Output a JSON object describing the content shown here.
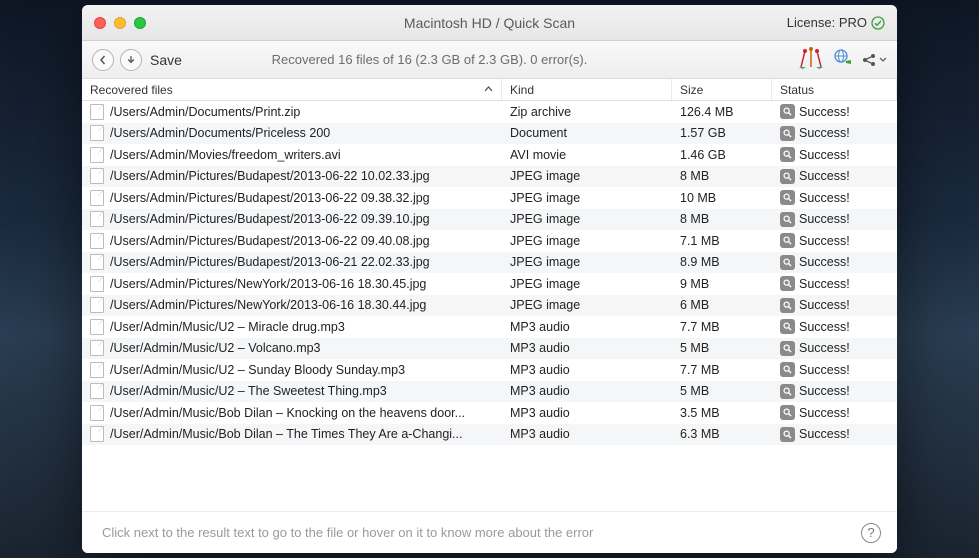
{
  "window": {
    "title": "Macintosh HD / Quick Scan",
    "license_label": "License: PRO"
  },
  "toolbar": {
    "save_label": "Save",
    "status": "Recovered 16 files of 16 (2.3 GB of 2.3 GB). 0 error(s)."
  },
  "columns": {
    "path": "Recovered files",
    "kind": "Kind",
    "size": "Size",
    "status": "Status"
  },
  "status_text": "Success!",
  "footer": {
    "hint": "Click next to the result text to go to the file or hover on it to know more about the error"
  },
  "rows": [
    {
      "path": "/Users/Admin/Documents/Print.zip",
      "kind": "Zip archive",
      "size": "126.4 MB"
    },
    {
      "path": "/Users/Admin/Documents/Priceless 200",
      "kind": "Document",
      "size": "1.57 GB"
    },
    {
      "path": "/Users/Admin/Movies/freedom_writers.avi",
      "kind": "AVI movie",
      "size": "1.46 GB"
    },
    {
      "path": "/Users/Admin/Pictures/Budapest/2013-06-22 10.02.33.jpg",
      "kind": "JPEG image",
      "size": "8 MB"
    },
    {
      "path": "/Users/Admin/Pictures/Budapest/2013-06-22 09.38.32.jpg",
      "kind": "JPEG image",
      "size": "10 MB"
    },
    {
      "path": "/Users/Admin/Pictures/Budapest/2013-06-22 09.39.10.jpg",
      "kind": "JPEG image",
      "size": "8 MB"
    },
    {
      "path": "/Users/Admin/Pictures/Budapest/2013-06-22 09.40.08.jpg",
      "kind": "JPEG image",
      "size": "7.1 MB"
    },
    {
      "path": "/Users/Admin/Pictures/Budapest/2013-06-21 22.02.33.jpg",
      "kind": "JPEG image",
      "size": "8.9 MB"
    },
    {
      "path": "/Users/Admin/Pictures/NewYork/2013-06-16 18.30.45.jpg",
      "kind": "JPEG image",
      "size": "9 MB"
    },
    {
      "path": "/Users/Admin/Pictures/NewYork/2013-06-16 18.30.44.jpg",
      "kind": "JPEG image",
      "size": "6 MB"
    },
    {
      "path": "/User/Admin/Music/U2 – Miracle drug.mp3",
      "kind": "MP3 audio",
      "size": "7.7 MB"
    },
    {
      "path": "/User/Admin/Music/U2 – Volcano.mp3",
      "kind": "MP3 audio",
      "size": "5 MB"
    },
    {
      "path": "/User/Admin/Music/U2 – Sunday Bloody Sunday.mp3",
      "kind": "MP3 audio",
      "size": "7.7 MB"
    },
    {
      "path": "/User/Admin/Music/U2 – The Sweetest Thing.mp3",
      "kind": "MP3 audio",
      "size": "5 MB"
    },
    {
      "path": "/User/Admin/Music/Bob Dilan – Knocking on the heavens door...",
      "kind": "MP3 audio",
      "size": "3.5 MB"
    },
    {
      "path": "/User/Admin/Music/Bob Dilan – The Times They Are a-Changi...",
      "kind": "MP3 audio",
      "size": "6.3 MB"
    }
  ]
}
